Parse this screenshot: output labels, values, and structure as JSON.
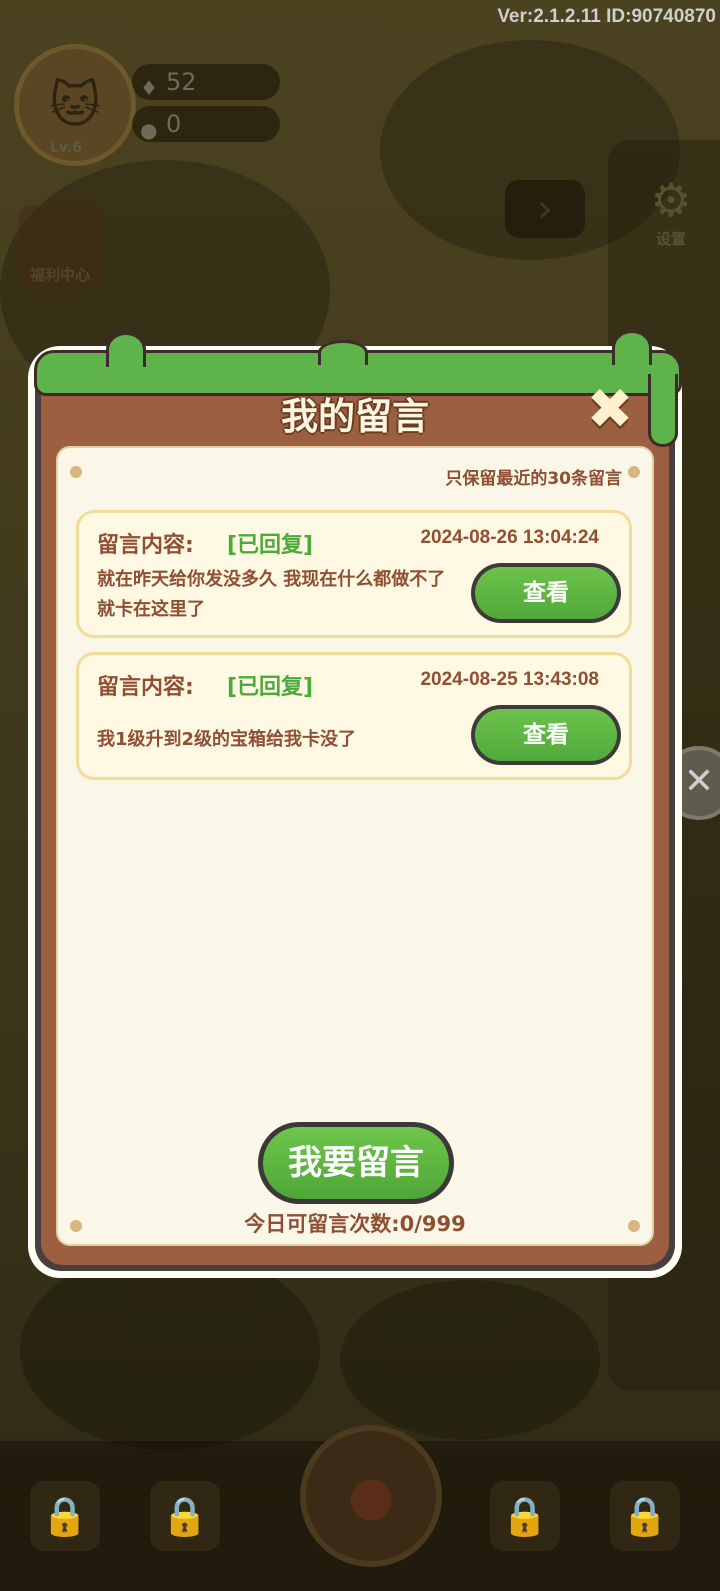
{
  "header": {
    "version_text": "Ver:2.1.2.11 ID:90740870"
  },
  "player": {
    "level": "Lv.6",
    "gems": "52",
    "coins": "0"
  },
  "side": {
    "welfare_label": "福利中心",
    "settings_label": "设置"
  },
  "dialog": {
    "title": "我的留言",
    "note": "只保留最近的30条留言",
    "messages": [
      {
        "label": "留言内容:",
        "status": "[已回复]",
        "time": "2024-08-26 13:04:24",
        "text": "就在昨天给你发没多久  我现在什么都做不了  就卡在这里了",
        "button": "查看"
      },
      {
        "label": "留言内容:",
        "status": "[已回复]",
        "time": "2024-08-25 13:43:08",
        "text": "我1级升到2级的宝箱给我卡没了",
        "button": "查看"
      }
    ],
    "leave_button": "我要留言",
    "daily_count": "今日可留言次数:0/999"
  },
  "colors": {
    "wood": "#9c5f3f",
    "paper": "#fbf7e8",
    "green_button": "#5db542",
    "status_green": "#4cab38",
    "text_brown": "#8f4f32"
  }
}
